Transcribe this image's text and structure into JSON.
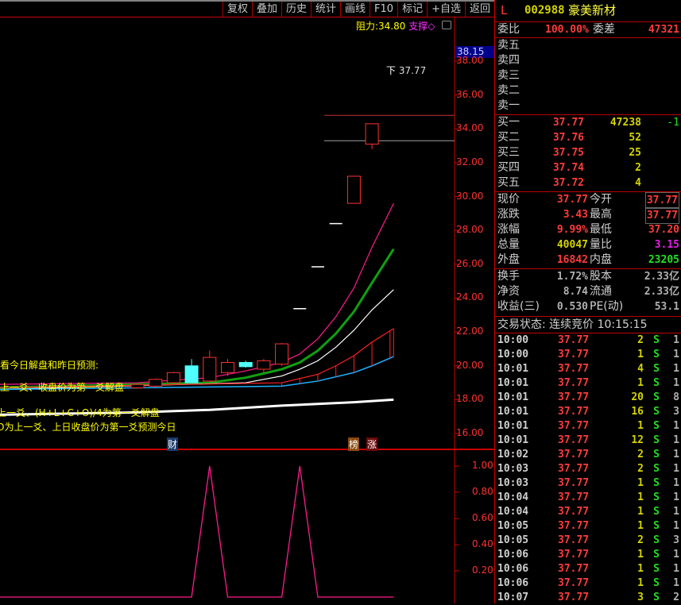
{
  "toolbar": [
    "复权",
    "叠加",
    "历史",
    "统计",
    "画线",
    "F10",
    "标记",
    "+自选",
    "返回"
  ],
  "chart": {
    "resistance_label": "阻力:",
    "resistance_value": "34.80",
    "support_label": "支撑◇",
    "current_price_tag": "38.15",
    "last_price_marker": "37.77",
    "y_ticks": [
      "38.00",
      "36.00",
      "34.00",
      "32.00",
      "30.00",
      "28.00",
      "26.00",
      "24.00",
      "22.00",
      "20.00",
      "18.00",
      "16.00"
    ],
    "notes": [
      "看今日解盘和昨日预测:",
      "上一爻、收盘价为第一爻解盘",
      "上一爻、(H+L+C+O)/4为第一爻解盘",
      "O为上一爻、上日收盘价为第一爻预测今日"
    ],
    "badges": [
      "财",
      "榜",
      "涨"
    ],
    "lower_ticks": [
      "1.00",
      "0.80",
      "0.60",
      "0.40",
      "0.20"
    ]
  },
  "chart_data": {
    "type": "candlestick",
    "ylim": [
      15.5,
      39
    ],
    "candles": [
      [
        18.7,
        18.9,
        18.95,
        18.65
      ],
      [
        18.8,
        19.2,
        19.25,
        18.75
      ],
      [
        19.0,
        19.6,
        19.65,
        18.95
      ],
      [
        20.0,
        19.0,
        20.4,
        19.0
      ],
      [
        19.1,
        20.5,
        20.9,
        19.05
      ],
      [
        19.6,
        20.2,
        20.4,
        19.4
      ],
      [
        20.2,
        19.95,
        20.3,
        19.9
      ],
      [
        19.8,
        20.3,
        20.4,
        19.6
      ],
      [
        20.1,
        21.3,
        21.35,
        20.0
      ],
      [
        23.38,
        23.38,
        23.38,
        23.38
      ],
      [
        25.85,
        25.85,
        25.85,
        25.85
      ],
      [
        28.4,
        28.4,
        28.4,
        28.4
      ],
      [
        29.6,
        31.2,
        31.2,
        29.6
      ],
      [
        33.1,
        34.3,
        34.3,
        32.8
      ]
    ],
    "lines": {
      "pink": [
        [
          -8,
          18.9
        ],
        [
          0,
          19.0
        ],
        [
          4,
          19.3
        ],
        [
          6,
          19.7
        ],
        [
          8,
          20.2
        ],
        [
          9,
          20.7
        ],
        [
          10,
          21.6
        ],
        [
          11,
          22.9
        ],
        [
          12,
          24.6
        ],
        [
          13,
          27.0
        ],
        [
          14.2,
          29.6
        ]
      ],
      "green": [
        [
          -8,
          18.7
        ],
        [
          4,
          19.0
        ],
        [
          6,
          19.3
        ],
        [
          8,
          19.8
        ],
        [
          9,
          20.2
        ],
        [
          10,
          20.9
        ],
        [
          11,
          21.9
        ],
        [
          12,
          23.2
        ],
        [
          13,
          24.9
        ],
        [
          14.2,
          26.9
        ]
      ],
      "white": [
        [
          -8,
          18.6
        ],
        [
          6,
          19.0
        ],
        [
          8,
          19.4
        ],
        [
          9,
          19.8
        ],
        [
          10,
          20.3
        ],
        [
          11,
          21.1
        ],
        [
          12,
          22.1
        ],
        [
          13,
          23.3
        ],
        [
          14.2,
          24.5
        ]
      ],
      "red": [
        [
          -8,
          18.7
        ],
        [
          8,
          19.0
        ],
        [
          10,
          19.5
        ],
        [
          11,
          20.0
        ],
        [
          12,
          20.6
        ],
        [
          13,
          21.4
        ],
        [
          14.2,
          22.2
        ]
      ],
      "blue": [
        [
          -8,
          18.6
        ],
        [
          8,
          18.8
        ],
        [
          10,
          19.1
        ],
        [
          12,
          19.6
        ],
        [
          13,
          20.0
        ],
        [
          14.2,
          20.55
        ]
      ],
      "base": [
        [
          -8,
          17.1
        ],
        [
          0,
          17.25
        ],
        [
          4,
          17.4
        ],
        [
          8,
          17.65
        ],
        [
          12,
          17.85
        ],
        [
          14.2,
          18.0
        ]
      ]
    },
    "levels": {
      "resistance": 34.8,
      "support": 33.3
    },
    "lower": {
      "ylim": [
        0,
        1.05
      ],
      "points": [
        [
          -8,
          0
        ],
        [
          3,
          0
        ],
        [
          4,
          1
        ],
        [
          5,
          0
        ],
        [
          8,
          0
        ],
        [
          9,
          1
        ],
        [
          10,
          0
        ],
        [
          14.2,
          0
        ]
      ]
    }
  },
  "quote": {
    "flag": "L",
    "code": "002988",
    "name": "豪美新材",
    "weibi_label": "委比",
    "weibi": "100.00%",
    "weicha_label": "委差",
    "weicha": "47321",
    "sell": [
      "卖五",
      "卖四",
      "卖三",
      "卖二",
      "卖一"
    ],
    "buy": [
      {
        "l": "买一",
        "p": "37.77",
        "v": "47238",
        "c": "-1"
      },
      {
        "l": "买二",
        "p": "37.76",
        "v": "52",
        "c": ""
      },
      {
        "l": "买三",
        "p": "37.75",
        "v": "25",
        "c": ""
      },
      {
        "l": "买四",
        "p": "37.74",
        "v": "2",
        "c": ""
      },
      {
        "l": "买五",
        "p": "37.72",
        "v": "4",
        "c": ""
      }
    ],
    "stats": [
      {
        "l1": "现价",
        "v1": "37.77",
        "l2": "今开",
        "v2": "37.77",
        "c1": "red",
        "c2": "red box"
      },
      {
        "l1": "涨跌",
        "v1": "3.43",
        "l2": "最高",
        "v2": "37.77",
        "c1": "red",
        "c2": "red box"
      },
      {
        "l1": "涨幅",
        "v1": "9.99%",
        "l2": "最低",
        "v2": "37.20",
        "c1": "red",
        "c2": "red"
      },
      {
        "l1": "总量",
        "v1": "40047",
        "l2": "量比",
        "v2": "3.15",
        "c1": "yel",
        "c2": "mag"
      },
      {
        "l1": "外盘",
        "v1": "16842",
        "l2": "内盘",
        "v2": "23205",
        "c1": "red",
        "c2": "grn"
      }
    ],
    "fin": [
      {
        "l1": "换手",
        "v1": "1.72%",
        "l2": "股本",
        "v2": "2.33亿"
      },
      {
        "l1": "净资",
        "v1": "8.74",
        "l2": "流通",
        "v2": "2.33亿"
      },
      {
        "l1": "收益(三)",
        "v1": "0.530",
        "l2": "PE(动)",
        "v2": "53.1"
      }
    ],
    "status": "交易状态: 连续竞价 10:15:15"
  },
  "ticks": [
    [
      "10:00",
      "37.77",
      "2",
      "S",
      "1"
    ],
    [
      "10:00",
      "37.77",
      "1",
      "S",
      "1"
    ],
    [
      "10:01",
      "37.77",
      "4",
      "S",
      "1"
    ],
    [
      "10:01",
      "37.77",
      "1",
      "S",
      "1"
    ],
    [
      "10:01",
      "37.77",
      "20",
      "S",
      "8"
    ],
    [
      "10:01",
      "37.77",
      "16",
      "S",
      "3"
    ],
    [
      "10:01",
      "37.77",
      "1",
      "S",
      "1"
    ],
    [
      "10:01",
      "37.77",
      "12",
      "S",
      "1"
    ],
    [
      "10:02",
      "37.77",
      "2",
      "S",
      "1"
    ],
    [
      "10:03",
      "37.77",
      "2",
      "S",
      "1"
    ],
    [
      "10:03",
      "37.77",
      "1",
      "S",
      "1"
    ],
    [
      "10:04",
      "37.77",
      "1",
      "S",
      "1"
    ],
    [
      "10:04",
      "37.77",
      "1",
      "S",
      "1"
    ],
    [
      "10:05",
      "37.77",
      "1",
      "S",
      "1"
    ],
    [
      "10:05",
      "37.77",
      "2",
      "S",
      "3"
    ],
    [
      "10:06",
      "37.77",
      "1",
      "S",
      "1"
    ],
    [
      "10:06",
      "37.77",
      "1",
      "S",
      "1"
    ],
    [
      "10:06",
      "37.77",
      "1",
      "S",
      "1"
    ],
    [
      "10:07",
      "37.77",
      "3",
      "S",
      "2"
    ]
  ]
}
